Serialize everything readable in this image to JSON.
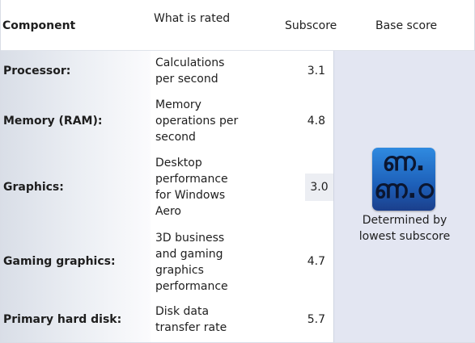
{
  "header": {
    "component": "Component",
    "what_is_rated": "What is rated",
    "subscore": "Subscore",
    "base_score": "Base score"
  },
  "rows": [
    {
      "name": "Processor:",
      "description": "Calculations per second",
      "subscore": "3.1"
    },
    {
      "name": "Memory (RAM):",
      "description": "Memory operations per second",
      "subscore": "4.8"
    },
    {
      "name": "Graphics:",
      "description": "Desktop performance for Windows Aero",
      "subscore": "3.0"
    },
    {
      "name": "Gaming graphics:",
      "description": "3D business and gaming graphics performance",
      "subscore": "4.7"
    },
    {
      "name": "Primary hard disk:",
      "description": "Disk data transfer rate",
      "subscore": "5.7"
    }
  ],
  "base": {
    "badge_top": "ണ.",
    "badge_bottom": "ണ.ഠ",
    "caption": "Determined by lowest subscore"
  },
  "colors": {
    "panel": "#e3e6f2",
    "badge": "#2f8ae0"
  },
  "icons": {
    "badge": "base-score-badge-icon"
  }
}
